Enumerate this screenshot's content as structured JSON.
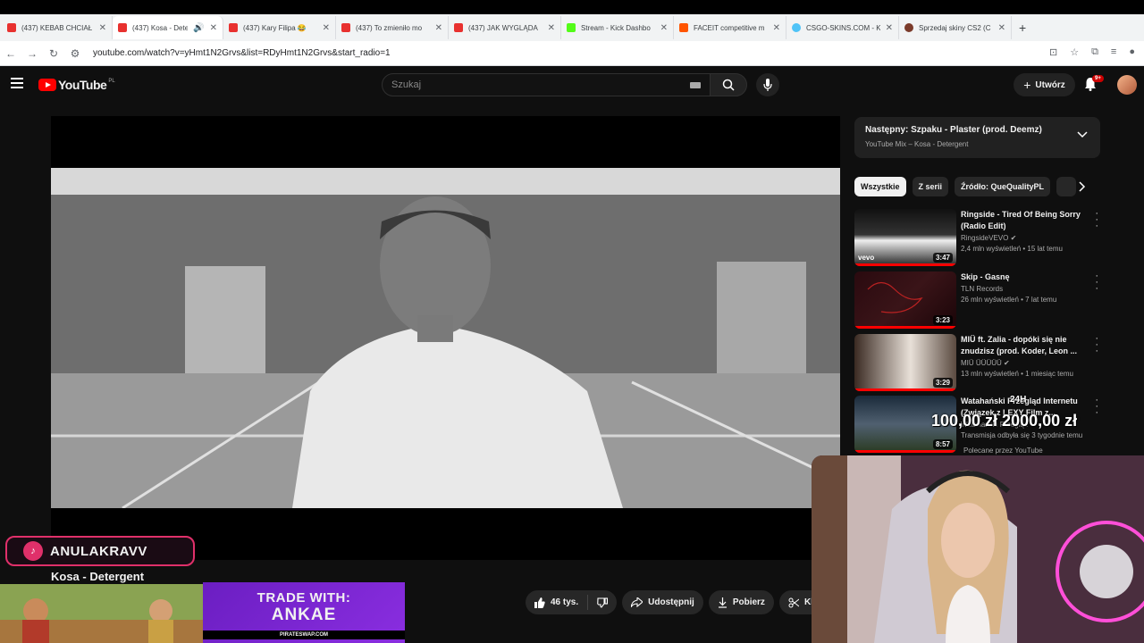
{
  "browser": {
    "tabs": [
      {
        "label": "(437) KEBAB CHCIAŁ",
        "fav": "#e8312f"
      },
      {
        "label": "(437) Kosa - Dete",
        "fav": "#e8312f",
        "active": true
      },
      {
        "label": "(437) Kary Filipa 😂",
        "fav": "#e8312f"
      },
      {
        "label": "(437) To zmieniło mo",
        "fav": "#e8312f"
      },
      {
        "label": "(437) JAK WYGLĄDA",
        "fav": "#e8312f"
      },
      {
        "label": "Stream - Kick Dashbo",
        "fav": "#53fc18"
      },
      {
        "label": "FACEIT competitive m",
        "fav": "#ff5500"
      },
      {
        "label": "CSGO-SKINS.COM - K",
        "fav": "#4fc3f7"
      },
      {
        "label": "Sprzedaj skiny CS2 (C",
        "fav": "#ffcc00"
      }
    ],
    "url": "youtube.com/watch?v=yHmt1N2Grvs&list=RDyHmt1N2Grvs&start_radio=1"
  },
  "youtube": {
    "logo_text": "YouTube",
    "country": "PL",
    "search_placeholder": "Szukaj",
    "create_label": "Utwórz",
    "notif_badge": "9+"
  },
  "video": {
    "title": "Kosa - Detergent",
    "likes": "46 tys.",
    "share_label": "Udostępnij",
    "download_label": "Pobierz",
    "clip_label": "Klip"
  },
  "sidebar": {
    "up_next_title": "Następny: Szpaku - Plaster (prod. Deemz)",
    "up_next_sub": "YouTube Mix – Kosa - Detergent",
    "chips": [
      "Wszystkie",
      "Z serii",
      "Źródło: QueQualityPL"
    ],
    "recommendations": [
      {
        "title": "Ringside - Tired Of Being Sorry (Radio Edit)",
        "channel": "RingsideVEVO",
        "verified": true,
        "meta": "2,4 mln wyświetleń • 15 lat temu",
        "duration": "3:47",
        "watched_pct": 100
      },
      {
        "title": "Skip - Gasnę",
        "channel": "TLN Records",
        "verified": false,
        "meta": "26 mln wyświetleń • 7 lat temu",
        "duration": "3:23",
        "watched_pct": 100
      },
      {
        "title": "MIÜ ft. Zalia - dopóki się nie znudzisz (prod. Koder, Leon ...",
        "channel": "MIÜ ÜÜÜÜÜ",
        "verified": true,
        "meta": "13 mln wyświetleń • 1 miesiąc temu",
        "duration": "3:29",
        "watched_pct": 100
      },
      {
        "title": "Watahański Przegląd Internetu (Związek z LEXY Film z...",
        "channel": "Watahański Przegląd",
        "verified": false,
        "meta": "Transmisja odbyła się 3 tygodnie temu",
        "duration": "8:57",
        "watched_pct": 100
      }
    ],
    "footer": "Polecane przez YouTube"
  },
  "overlays": {
    "price_line": "100,00 zł  2000,00 zł",
    "tag_24h": "24H",
    "tiktok_name": "ANULAKRAVV",
    "trade_line1": "TRADE WITH:",
    "trade_line2": "ANKAE",
    "trade_site": "PIRATESWAP.COM"
  }
}
